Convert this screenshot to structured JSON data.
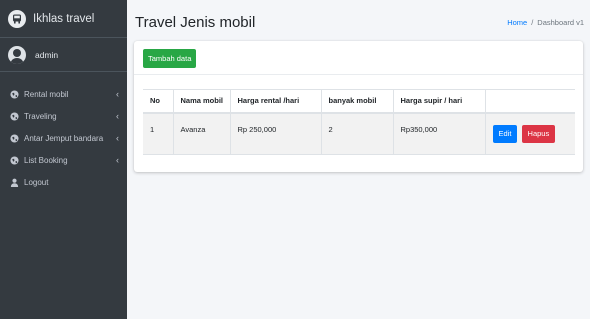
{
  "brand": {
    "name": "Ikhlas travel",
    "icon": "bus-logo-icon"
  },
  "user": {
    "name": "admin"
  },
  "sidebar": {
    "items": [
      {
        "label": "Rental mobil",
        "icon": "globe-icon",
        "has_submenu": true
      },
      {
        "label": "Traveling",
        "icon": "globe-icon",
        "has_submenu": true
      },
      {
        "label": "Antar Jemput bandara",
        "icon": "globe-icon",
        "has_submenu": true
      },
      {
        "label": "List Booking",
        "icon": "globe-icon",
        "has_submenu": true
      },
      {
        "label": "Logout",
        "icon": "user-icon",
        "has_submenu": false
      }
    ],
    "chevron": "‹"
  },
  "header": {
    "title": "Travel Jenis mobil",
    "breadcrumb": {
      "home": "Home",
      "separator": "/",
      "current": "Dashboard v1"
    }
  },
  "card": {
    "add_button": "Tambah data",
    "table": {
      "columns": [
        "No",
        "Nama mobil",
        "Harga rental /hari",
        "banyak mobil",
        "Harga supir / hari",
        ""
      ],
      "rows": [
        {
          "no": "1",
          "nama": "Avanza",
          "harga_rental": "Rp 250,000",
          "banyak": "2",
          "harga_supir": "Rp350,000",
          "edit": "Edit",
          "hapus": "Hapus"
        }
      ]
    }
  },
  "colors": {
    "sidebar": "#343a40",
    "success": "#28a745",
    "primary": "#007bff",
    "danger": "#dc3545"
  }
}
